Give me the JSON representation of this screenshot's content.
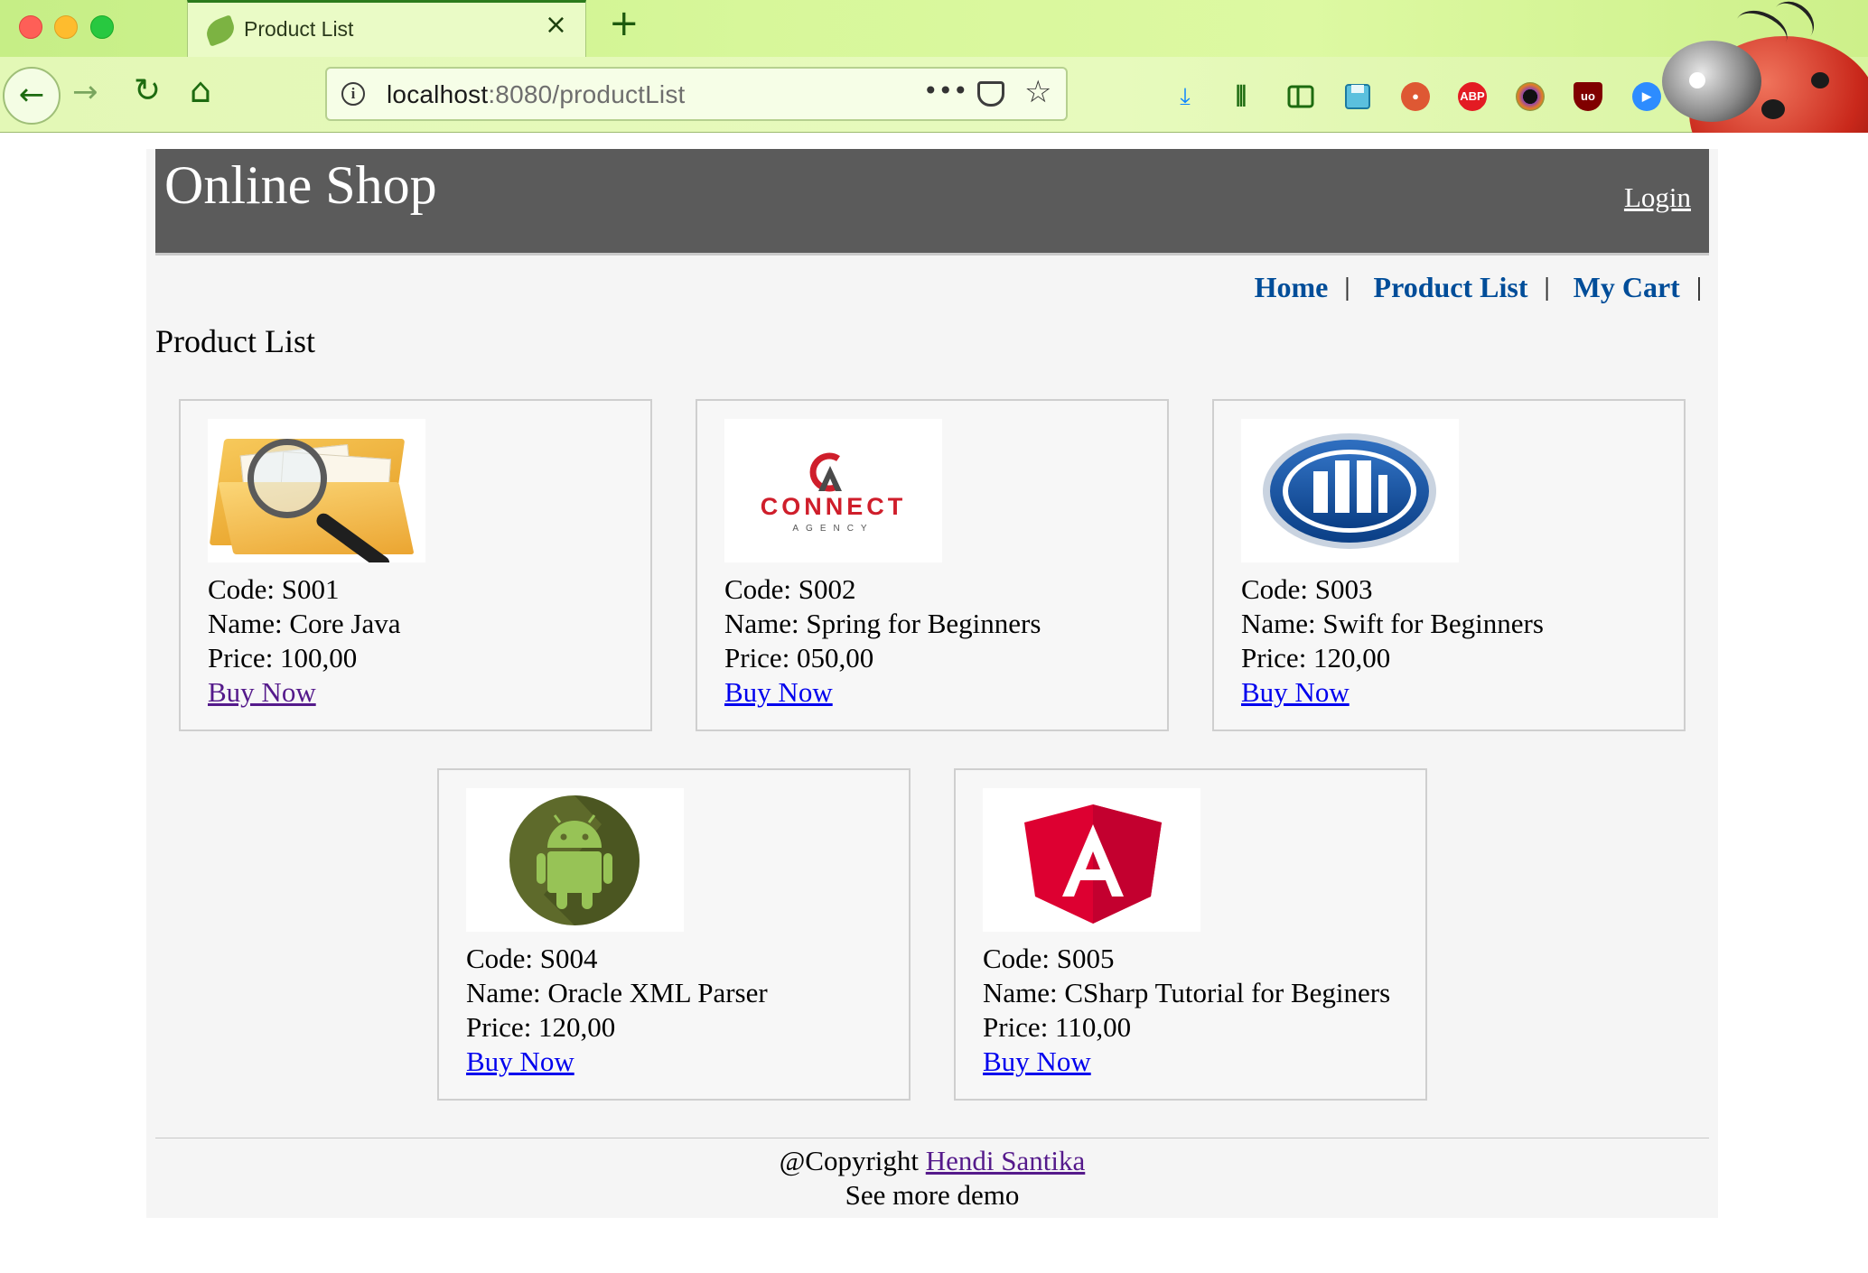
{
  "browser": {
    "tab_title": "Product List",
    "url_host": "localhost",
    "url_path": ":8080/productList",
    "toolbar_icons": [
      "download-icon",
      "library-icon",
      "sidebar-icon",
      "save-icon",
      "duckduckgo-icon",
      "adblock-icon",
      "color-picker-icon",
      "ublock-icon",
      "zoom-icon",
      "translate-icon",
      "extension-icon",
      "menu-icon"
    ],
    "adblock_label": "ABP",
    "ublock_label": "uo"
  },
  "header": {
    "title": "Online Shop",
    "login": "Login"
  },
  "menu": {
    "items": [
      {
        "label": "Home"
      },
      {
        "label": "Product List"
      },
      {
        "label": "My Cart"
      }
    ],
    "separator": "|"
  },
  "page_title": "Product List",
  "products": [
    {
      "code": "Code: S001",
      "name": "Name: Core Java",
      "price": "Price: 100,00",
      "buy": "Buy Now",
      "image": "folder-magnifier",
      "visited": true
    },
    {
      "code": "Code: S002",
      "name": "Name: Spring for Beginners",
      "price": "Price: 050,00",
      "buy": "Buy Now",
      "image": "connect-agency-logo",
      "logo_text": "CONNECT",
      "logo_subtext": "AGENCY"
    },
    {
      "code": "Code: S003",
      "name": "Name: Swift for Beginners",
      "price": "Price: 120,00",
      "buy": "Buy Now",
      "image": "allianz-logo"
    },
    {
      "code": "Code: S004",
      "name": "Name: Oracle XML Parser",
      "price": "Price: 120,00",
      "buy": "Buy Now",
      "image": "android-logo"
    },
    {
      "code": "Code: S005",
      "name": "Name: CSharp Tutorial for Beginers",
      "price": "Price: 110,00",
      "buy": "Buy Now",
      "image": "angular-logo"
    }
  ],
  "footer": {
    "copyright": "@Copyright ",
    "author": "Hendi Santika",
    "more": "See more demo"
  },
  "colors": {
    "header_bg": "#5b5b5b",
    "menu_link": "#004d99",
    "link": "#0000ee",
    "visited_link": "#551a8b",
    "page_bg": "#f5f5f5"
  }
}
